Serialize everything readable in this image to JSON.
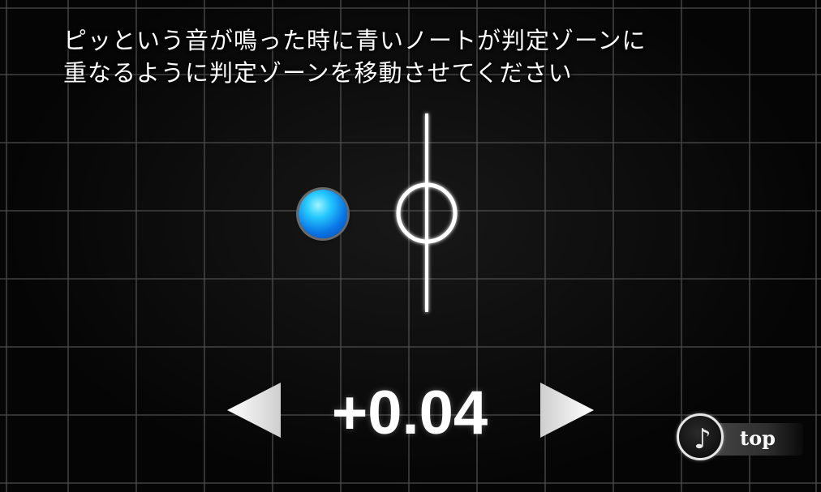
{
  "instruction": {
    "line1": "ピッという音が鳴った時に青いノートが判定ゾーンに",
    "line2": "重なるように判定ゾーンを移動させてください"
  },
  "offset": {
    "value": "+0.04"
  },
  "controls": {
    "decrease_icon": "left-triangle-arrow",
    "increase_icon": "right-triangle-arrow"
  },
  "top_button": {
    "label": "top",
    "icon": "music-note-icon",
    "glyph": "♪"
  },
  "colors": {
    "background": "#050505",
    "grid": "#5a5a5a",
    "track": "#ffffff",
    "note": "#0a8ff0"
  }
}
